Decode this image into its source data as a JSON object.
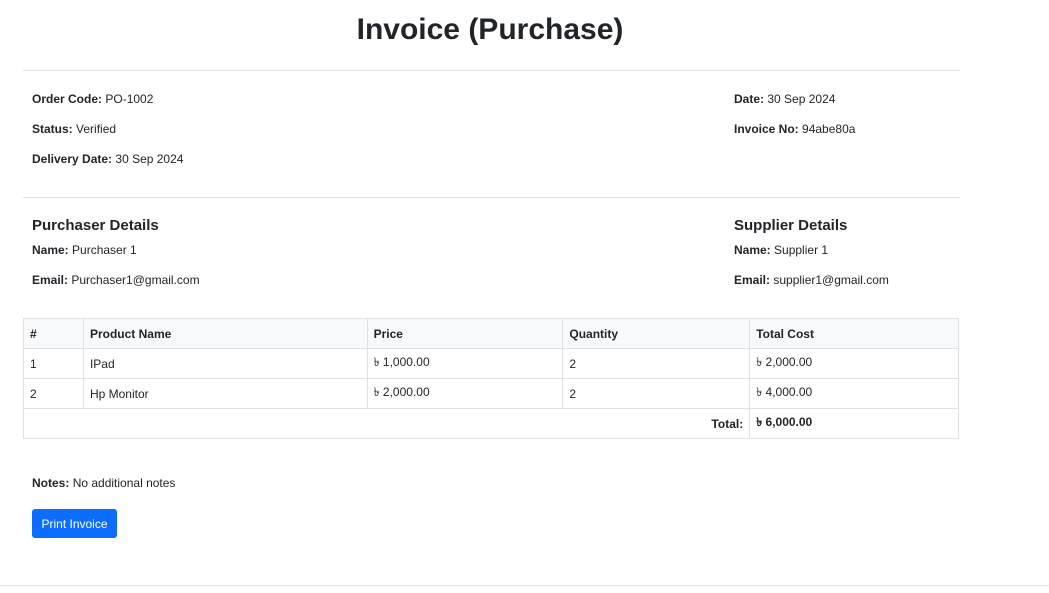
{
  "title": "Invoice (Purchase)",
  "order": {
    "code_label": "Order Code:",
    "code": "PO-1002",
    "status_label": "Status:",
    "status": "Verified",
    "delivery_label": "Delivery Date:",
    "delivery_date": "30 Sep 2024",
    "date_label": "Date:",
    "date": "30 Sep 2024",
    "invoice_label": "Invoice No:",
    "invoice_no": "94abe80a"
  },
  "purchaser": {
    "heading": "Purchaser Details",
    "name_label": "Name:",
    "name": "Purchaser 1",
    "email_label": "Email:",
    "email": "Purchaser1@gmail.com"
  },
  "supplier": {
    "heading": "Supplier Details",
    "name_label": "Name:",
    "name": "Supplier 1",
    "email_label": "Email:",
    "email": "supplier1@gmail.com"
  },
  "table": {
    "headers": [
      "#",
      "Product Name",
      "Price",
      "Quantity",
      "Total Cost"
    ],
    "rows": [
      [
        "1",
        "IPad",
        "৳ 1,000.00",
        "2",
        "৳ 2,000.00"
      ],
      [
        "2",
        "Hp Monitor",
        "৳ 2,000.00",
        "2",
        "৳ 4,000.00"
      ]
    ],
    "total_label": "Total:",
    "total_value": "৳ 6,000.00"
  },
  "notes": {
    "label": "Notes:",
    "text": "No additional notes"
  },
  "print_button": "Print Invoice"
}
